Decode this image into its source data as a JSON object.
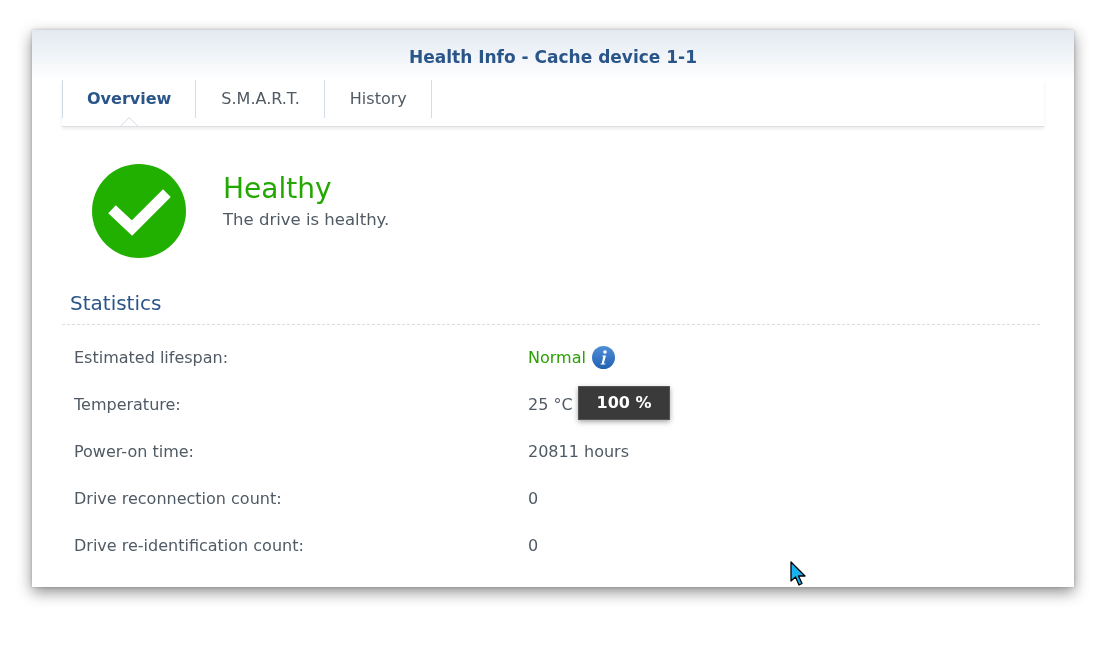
{
  "window": {
    "title": "Health Info - Cache device 1-1"
  },
  "tabs": [
    {
      "label": "Overview",
      "selected": true
    },
    {
      "label": "S.M.A.R.T.",
      "selected": false
    },
    {
      "label": "History",
      "selected": false
    }
  ],
  "health": {
    "status": "Healthy",
    "description": "The drive is healthy."
  },
  "statistics": {
    "title": "Statistics",
    "rows": [
      {
        "label": "Estimated lifespan:",
        "value": "Normal",
        "kind": "status"
      },
      {
        "label": "Temperature:",
        "value": "25 °C",
        "kind": "text"
      },
      {
        "label": "Power-on time:",
        "value": "20811 hours",
        "kind": "text"
      },
      {
        "label": "Drive reconnection count:",
        "value": "0",
        "kind": "text"
      },
      {
        "label": "Drive re-identification count:",
        "value": "0",
        "kind": "text"
      }
    ]
  },
  "tooltip": {
    "text": "100 %"
  }
}
